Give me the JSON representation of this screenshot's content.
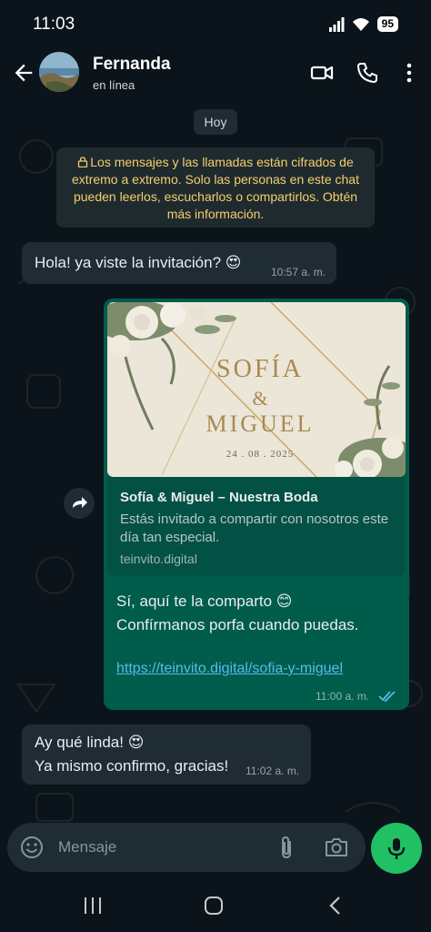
{
  "status": {
    "time": "11:03",
    "battery": "95"
  },
  "header": {
    "name": "Fernanda",
    "status": "en línea"
  },
  "chat": {
    "date_chip": "Hoy",
    "encryption_notice": "Los mensajes y las llamadas están cifrados de extremo a extremo. Solo las personas en este chat pueden leerlos, escucharlos o compartirlos. Obtén más información.",
    "messages": [
      {
        "direction": "in",
        "text": "Hola! ya viste la invitación? 😍",
        "time": "10:57 a. m."
      },
      {
        "direction": "out",
        "card": {
          "name1": "SOFÍA",
          "amp": "&",
          "name2": "MIGUEL",
          "date": "24 . 08 . 2025"
        },
        "preview_title": "Sofía & Miguel – Nuestra Boda",
        "preview_desc": "Estás invitado a compartir con nosotros este día tan especial.",
        "preview_domain": "teinvito.digital",
        "line1": "Sí, aquí te la comparto 😊",
        "line2": "Confírmanos porfa cuando puedas.",
        "link": "https://teinvito.digital/sofia-y-miguel",
        "time": "11:00 a. m."
      },
      {
        "direction": "in",
        "line1": "Ay qué linda! 😍",
        "line2": "Ya mismo confirmo, gracias!",
        "time": "11:02 a. m."
      }
    ]
  },
  "input": {
    "placeholder": "Mensaje"
  },
  "icons": [
    "back-icon",
    "video-call-icon",
    "phone-icon",
    "more-icon",
    "lock-icon",
    "forward-icon",
    "double-check-icon",
    "emoji-icon",
    "attach-icon",
    "camera-icon",
    "mic-icon",
    "recents-icon",
    "home-icon",
    "back-nav-icon"
  ],
  "colors": {
    "bg": "#0b141a",
    "incoming": "#1f2c34",
    "outgoing": "#005c4b",
    "accent": "#21c063",
    "link": "#53bdeb",
    "notice": "#f5cf6a"
  }
}
